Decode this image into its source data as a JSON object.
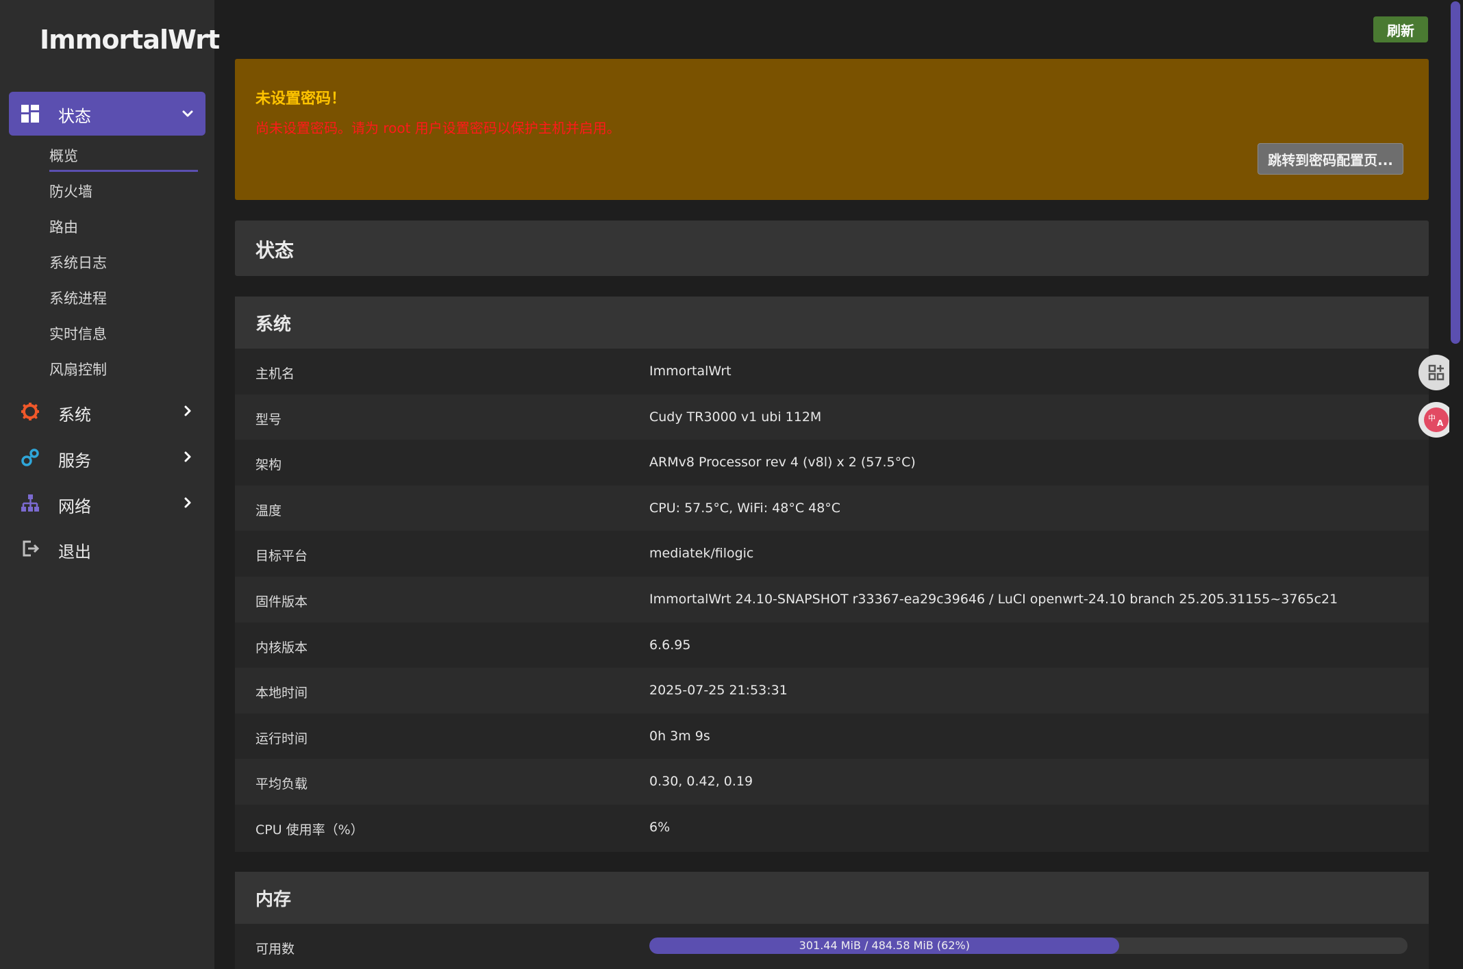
{
  "brand": "ImmortalWrt",
  "sidebar": {
    "status": {
      "label": "状态",
      "items": [
        "概览",
        "防火墙",
        "路由",
        "系统日志",
        "系统进程",
        "实时信息",
        "风扇控制"
      ]
    },
    "system": "系统",
    "services": "服务",
    "network": "网络",
    "logout": "退出"
  },
  "toolbar": {
    "refresh_label": "刷新"
  },
  "alert": {
    "title": "未设置密码！",
    "message": "尚未设置密码。请为 root 用户设置密码以保护主机并启用。",
    "button": "跳转到密码配置页..."
  },
  "page_title": "状态",
  "system_section": {
    "title": "系统",
    "rows": [
      {
        "k": "主机名",
        "v": "ImmortalWrt"
      },
      {
        "k": "型号",
        "v": "Cudy TR3000 v1 ubi 112M"
      },
      {
        "k": "架构",
        "v": "ARMv8 Processor rev 4 (v8l) x 2 (57.5°C)"
      },
      {
        "k": "温度",
        "v": "CPU: 57.5°C, WiFi: 48°C 48°C"
      },
      {
        "k": "目标平台",
        "v": "mediatek/filogic"
      },
      {
        "k": "固件版本",
        "v": "ImmortalWrt 24.10-SNAPSHOT r33367-ea29c39646 / LuCI openwrt-24.10 branch 25.205.31155~3765c21"
      },
      {
        "k": "内核版本",
        "v": "6.6.95"
      },
      {
        "k": "本地时间",
        "v": "2025-07-25 21:53:31"
      },
      {
        "k": "运行时间",
        "v": "0h 3m 9s"
      },
      {
        "k": "平均负载",
        "v": "0.30, 0.42, 0.19"
      },
      {
        "k": "CPU 使用率（%）",
        "v": "6%"
      }
    ]
  },
  "memory_section": {
    "title": "内存",
    "available_label": "可用数",
    "available_text": "301.44 MiB / 484.58 MiB (62%)",
    "available_fraction": 0.62
  },
  "colors": {
    "accent": "#5b4fb0",
    "alert_bg": "#7a5200",
    "alert_title": "#ffc400",
    "alert_text": "#ff1a1a",
    "refresh": "#4a7a32"
  },
  "icons": [
    "grid-icon",
    "gear-icon",
    "services-icon",
    "network-icon",
    "logout-icon",
    "chevron-down-icon",
    "chevron-right-icon",
    "qr-icon",
    "translate-icon"
  ]
}
